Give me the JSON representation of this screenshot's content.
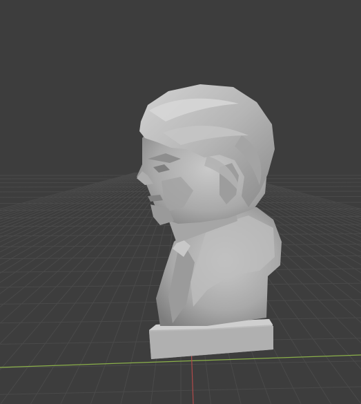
{
  "viewport": {
    "background_color": "#3d3d3d",
    "grid_color": "#4a4a4a",
    "x_axis_color": "#8bb04a",
    "y_axis_color": "#b04a4a",
    "grid_visible": true,
    "view": "perspective"
  },
  "scene": {
    "object": "sculpted-bust",
    "material_color": "#b8b8b8",
    "shading": "solid"
  }
}
